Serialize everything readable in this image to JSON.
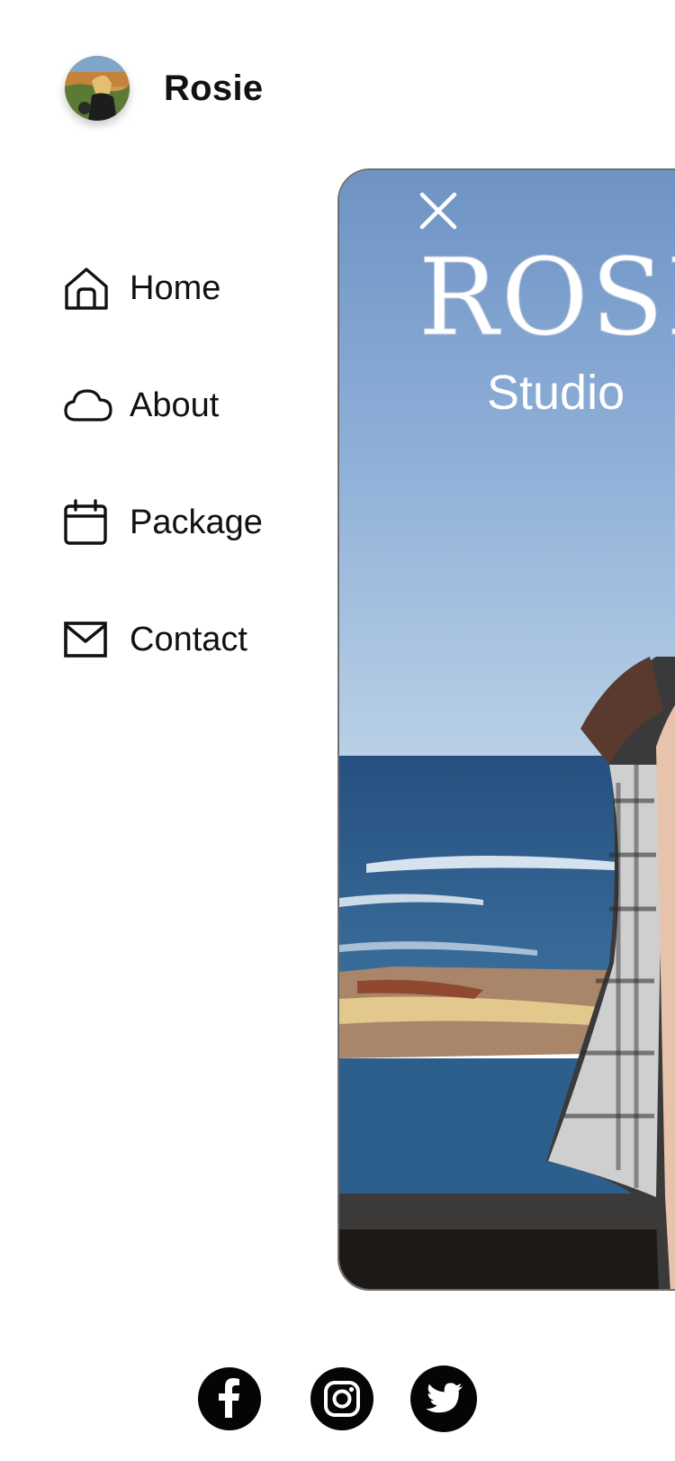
{
  "header": {
    "name": "Rosie",
    "avatar_icon": "profile-avatar"
  },
  "nav": {
    "items": [
      {
        "label": "Home",
        "icon": "home-icon"
      },
      {
        "label": "About",
        "icon": "cloud-icon"
      },
      {
        "label": "Package",
        "icon": "calendar-icon"
      },
      {
        "label": "Contact",
        "icon": "mail-icon"
      }
    ]
  },
  "hero": {
    "title": "ROSIE",
    "subtitle": "Studio",
    "close_icon": "close-icon"
  },
  "social": {
    "items": [
      {
        "icon": "facebook-icon"
      },
      {
        "icon": "instagram-icon"
      },
      {
        "icon": "twitter-icon"
      }
    ]
  },
  "colors": {
    "text": "#111111",
    "sky_top": "#6e93c4",
    "sea": "#2c5b86",
    "social_bg": "#050505"
  }
}
